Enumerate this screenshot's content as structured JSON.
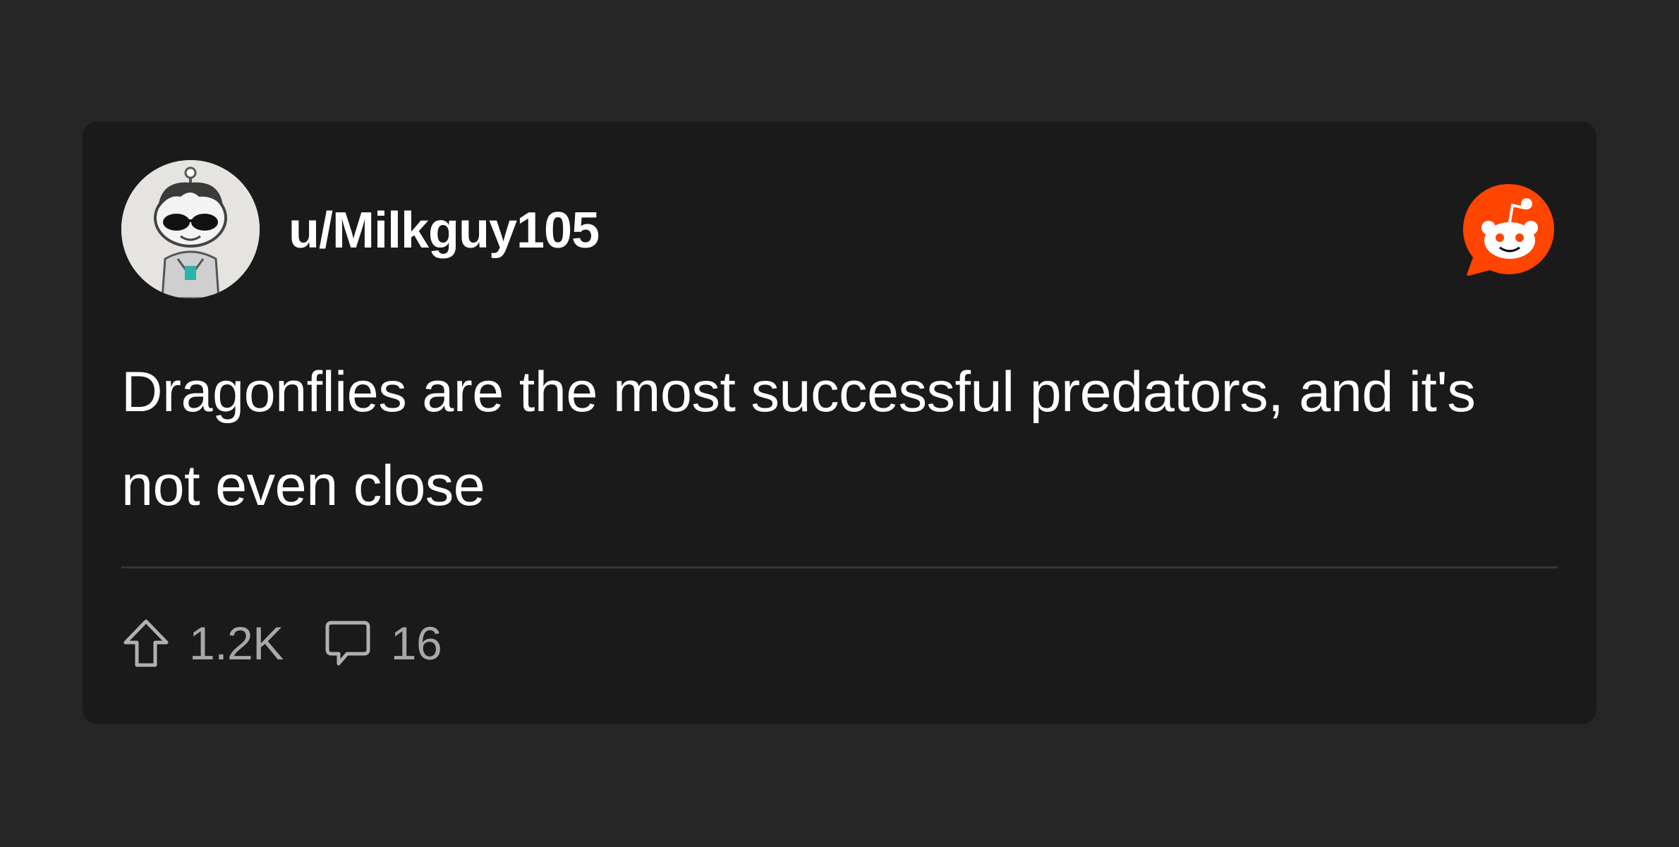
{
  "post": {
    "username": "u/Milkguy105",
    "title": "Dragonflies are the most successful predators, and it's not even close",
    "upvotes": "1.2K",
    "comments": "16"
  },
  "icons": {
    "avatar": "user-avatar-snoo-sunglasses",
    "brand": "reddit-logo",
    "upvote": "upvote-arrow-icon",
    "comments": "comment-bubble-icon"
  },
  "colors": {
    "page_background": "#262626",
    "card_background": "#1a1a1a",
    "reddit_orange": "#ff4500",
    "text_primary": "#ffffff",
    "text_muted": "#a8a8a8"
  }
}
